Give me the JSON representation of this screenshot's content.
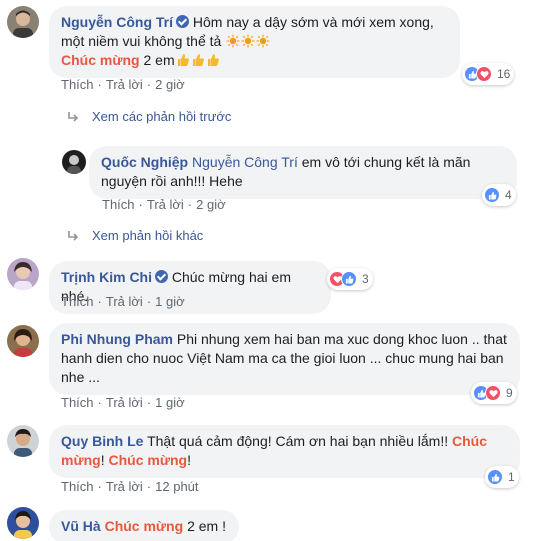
{
  "comments": [
    {
      "name": "Nguyễn Công Trí",
      "text_1": "Hôm nay a dậy sớm và mới xem xong, một niềm vui không thể tả",
      "hl": "Chúc mừng",
      "text_2": "2 em",
      "like": "Thích",
      "reply": "Trả lời",
      "time": "2 giờ",
      "reactions": "16"
    },
    {
      "name": "Quốc Nghiệp",
      "tag": "Nguyễn Công Trí",
      "text": "em vô tới chung kết là mãn nguyện rồi anh!!! Hehe",
      "like": "Thích",
      "reply": "Trả lời",
      "time": "2 giờ",
      "reactions": "4"
    },
    {
      "name": "Trịnh Kim Chi",
      "text": "Chúc mừng hai em nhé.",
      "like": "Thích",
      "reply": "Trả lời",
      "time": "1 giờ",
      "reactions": "3"
    },
    {
      "name": "Phi Nhung Pham",
      "text": "Phi nhung xem hai ban ma xuc dong khoc luon .. that hanh dien cho nuoc Việt Nam ma ca the gioi luon ... chuc mung hai ban nhe ...",
      "like": "Thích",
      "reply": "Trả lời",
      "time": "1 giờ",
      "reactions": "9"
    },
    {
      "name": "Quy Binh Le",
      "text_1": "Thật quá cảm động! Cám ơn hai bạn nhiều lắm!!",
      "hl_1": "Chúc mừng",
      "sep": "!",
      "hl_2": "Chúc mừng",
      "end": "!",
      "like": "Thích",
      "reply": "Trả lời",
      "time": "12 phút",
      "reactions": "1"
    },
    {
      "name": "Vũ Hà",
      "hl": "Chúc mừng",
      "text": "2 em !"
    }
  ],
  "links": {
    "previous_replies": "Xem các phản hồi trước",
    "other_replies": "Xem phản hồi khác"
  },
  "colors": {
    "name": "#385898",
    "highlight": "#e9573f",
    "bubble": "#f2f3f5",
    "like": "#5890ff",
    "love": "#f25268"
  }
}
